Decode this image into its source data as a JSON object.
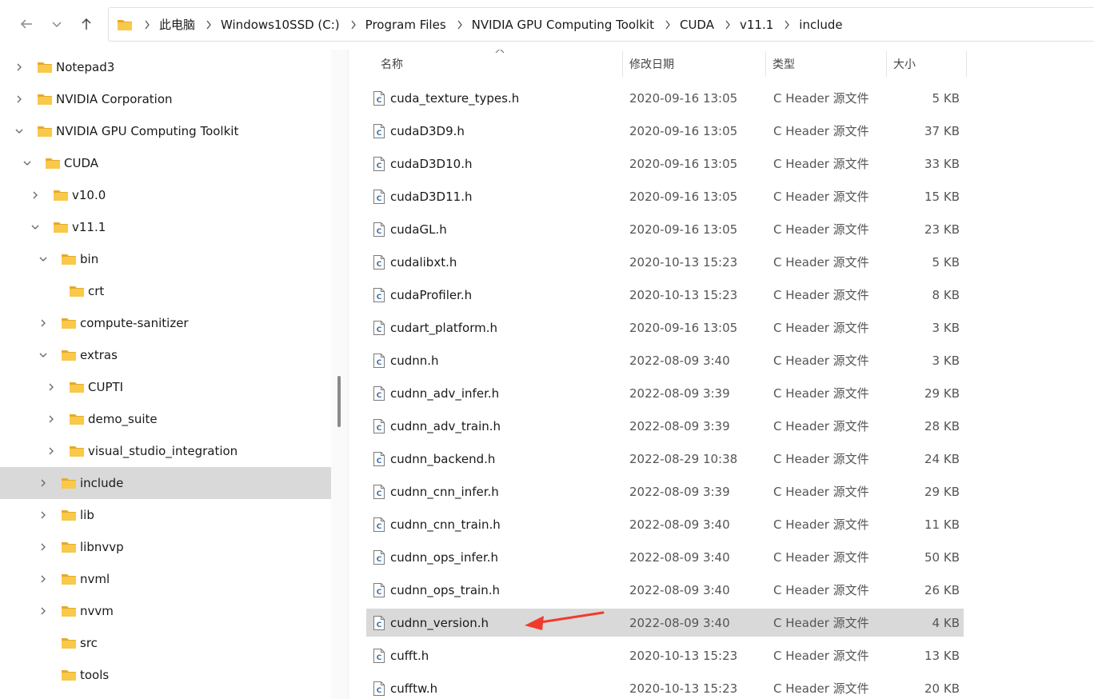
{
  "nav": {
    "back_icon": "arrow-left-icon",
    "recent_icon": "chevron-down-icon",
    "up_icon": "arrow-up-icon"
  },
  "breadcrumb": [
    "此电脑",
    "Windows10SSD (C:)",
    "Program Files",
    "NVIDIA GPU Computing Toolkit",
    "CUDA",
    "v11.1",
    "include"
  ],
  "sidebar": {
    "items": [
      {
        "label": "Notepad3",
        "level": 0,
        "expander": "collapsed",
        "selected": false
      },
      {
        "label": "NVIDIA Corporation",
        "level": 0,
        "expander": "collapsed",
        "selected": false
      },
      {
        "label": "NVIDIA GPU Computing Toolkit",
        "level": 0,
        "expander": "expanded",
        "selected": false
      },
      {
        "label": "CUDA",
        "level": 1,
        "expander": "expanded",
        "selected": false
      },
      {
        "label": "v10.0",
        "level": 2,
        "expander": "collapsed",
        "selected": false
      },
      {
        "label": "v11.1",
        "level": 2,
        "expander": "expanded",
        "selected": false
      },
      {
        "label": "bin",
        "level": 3,
        "expander": "expanded",
        "selected": false
      },
      {
        "label": "crt",
        "level": 4,
        "expander": "none",
        "selected": false
      },
      {
        "label": "compute-sanitizer",
        "level": 3,
        "expander": "collapsed",
        "selected": false
      },
      {
        "label": "extras",
        "level": 3,
        "expander": "expanded",
        "selected": false
      },
      {
        "label": "CUPTI",
        "level": 4,
        "expander": "collapsed",
        "selected": false
      },
      {
        "label": "demo_suite",
        "level": 4,
        "expander": "collapsed",
        "selected": false
      },
      {
        "label": "visual_studio_integration",
        "level": 4,
        "expander": "collapsed",
        "selected": false
      },
      {
        "label": "include",
        "level": 3,
        "expander": "collapsed",
        "selected": true
      },
      {
        "label": "lib",
        "level": 3,
        "expander": "collapsed",
        "selected": false
      },
      {
        "label": "libnvvp",
        "level": 3,
        "expander": "collapsed",
        "selected": false
      },
      {
        "label": "nvml",
        "level": 3,
        "expander": "collapsed",
        "selected": false
      },
      {
        "label": "nvvm",
        "level": 3,
        "expander": "collapsed",
        "selected": false
      },
      {
        "label": "src",
        "level": 3,
        "expander": "none",
        "selected": false
      },
      {
        "label": "tools",
        "level": 3,
        "expander": "none",
        "selected": false
      }
    ]
  },
  "columns": {
    "name": "名称",
    "date": "修改日期",
    "type": "类型",
    "size": "大小"
  },
  "files": [
    {
      "name": "cuda_texture_types.h",
      "date": "2020-09-16 13:05",
      "type": "C Header 源文件",
      "size": "5 KB",
      "highlighted": false
    },
    {
      "name": "cudaD3D9.h",
      "date": "2020-09-16 13:05",
      "type": "C Header 源文件",
      "size": "37 KB",
      "highlighted": false
    },
    {
      "name": "cudaD3D10.h",
      "date": "2020-09-16 13:05",
      "type": "C Header 源文件",
      "size": "33 KB",
      "highlighted": false
    },
    {
      "name": "cudaD3D11.h",
      "date": "2020-09-16 13:05",
      "type": "C Header 源文件",
      "size": "15 KB",
      "highlighted": false
    },
    {
      "name": "cudaGL.h",
      "date": "2020-09-16 13:05",
      "type": "C Header 源文件",
      "size": "23 KB",
      "highlighted": false
    },
    {
      "name": "cudalibxt.h",
      "date": "2020-10-13 15:23",
      "type": "C Header 源文件",
      "size": "5 KB",
      "highlighted": false
    },
    {
      "name": "cudaProfiler.h",
      "date": "2020-10-13 15:23",
      "type": "C Header 源文件",
      "size": "8 KB",
      "highlighted": false
    },
    {
      "name": "cudart_platform.h",
      "date": "2020-09-16 13:05",
      "type": "C Header 源文件",
      "size": "3 KB",
      "highlighted": false
    },
    {
      "name": "cudnn.h",
      "date": "2022-08-09 3:40",
      "type": "C Header 源文件",
      "size": "3 KB",
      "highlighted": false
    },
    {
      "name": "cudnn_adv_infer.h",
      "date": "2022-08-09 3:39",
      "type": "C Header 源文件",
      "size": "29 KB",
      "highlighted": false
    },
    {
      "name": "cudnn_adv_train.h",
      "date": "2022-08-09 3:39",
      "type": "C Header 源文件",
      "size": "28 KB",
      "highlighted": false
    },
    {
      "name": "cudnn_backend.h",
      "date": "2022-08-29 10:38",
      "type": "C Header 源文件",
      "size": "24 KB",
      "highlighted": false
    },
    {
      "name": "cudnn_cnn_infer.h",
      "date": "2022-08-09 3:39",
      "type": "C Header 源文件",
      "size": "29 KB",
      "highlighted": false
    },
    {
      "name": "cudnn_cnn_train.h",
      "date": "2022-08-09 3:40",
      "type": "C Header 源文件",
      "size": "11 KB",
      "highlighted": false
    },
    {
      "name": "cudnn_ops_infer.h",
      "date": "2022-08-09 3:40",
      "type": "C Header 源文件",
      "size": "50 KB",
      "highlighted": false
    },
    {
      "name": "cudnn_ops_train.h",
      "date": "2022-08-09 3:40",
      "type": "C Header 源文件",
      "size": "26 KB",
      "highlighted": false
    },
    {
      "name": "cudnn_version.h",
      "date": "2022-08-09 3:40",
      "type": "C Header 源文件",
      "size": "4 KB",
      "highlighted": true
    },
    {
      "name": "cufft.h",
      "date": "2020-10-13 15:23",
      "type": "C Header 源文件",
      "size": "13 KB",
      "highlighted": false
    },
    {
      "name": "cufftw.h",
      "date": "2020-10-13 15:23",
      "type": "C Header 源文件",
      "size": "20 KB",
      "highlighted": false
    }
  ],
  "colors": {
    "folder": "#f8c94a",
    "folder_dark": "#e7a92a",
    "selection": "#d9d9d9",
    "annotation_arrow": "#f23a2c"
  }
}
